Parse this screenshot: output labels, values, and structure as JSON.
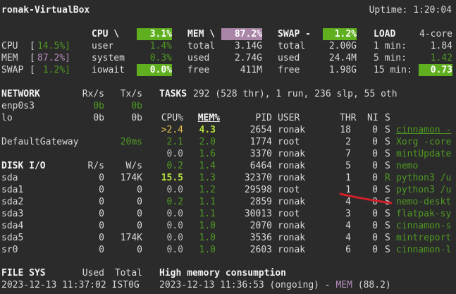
{
  "header": {
    "host": "ronak-VirtualBox",
    "uptime": "Uptime: 1:20:04"
  },
  "quicklook": {
    "cpu": {
      "label": "CPU",
      "bar": "[",
      "value": "14.5%]"
    },
    "mem": {
      "label": "MEM",
      "bar": "[",
      "value": "87.2%]"
    },
    "swap": {
      "label": "SWAP",
      "bar": "[",
      "value": " 1.2%]"
    }
  },
  "cpu_block": {
    "title": "CPU \\",
    "total": "3.1%",
    "rows": [
      {
        "label": "user",
        "value": "1.4%"
      },
      {
        "label": "system",
        "value": "0.3%"
      },
      {
        "label": "iowait",
        "value": "0.0%"
      }
    ]
  },
  "mem_block": {
    "title": "MEM \\",
    "total": "87.2%",
    "rows": [
      {
        "label": "total",
        "value": "3.14G"
      },
      {
        "label": "used",
        "value": "2.74G"
      },
      {
        "label": "free",
        "value": "411M"
      }
    ]
  },
  "swap_block": {
    "title": "SWAP -",
    "total": "1.2%",
    "rows": [
      {
        "label": "total",
        "value": "2.00G"
      },
      {
        "label": "used",
        "value": "24.4M"
      },
      {
        "label": "free",
        "value": "1.98G"
      }
    ]
  },
  "load_block": {
    "title": "LOAD",
    "cores": "4-core",
    "rows": [
      {
        "label": "1 min:",
        "value": "1.84"
      },
      {
        "label": "5 min:",
        "value": "1.42"
      },
      {
        "label": "15 min:",
        "value": "0.73"
      }
    ]
  },
  "network": {
    "title": "NETWORK",
    "rx": "Rx/s",
    "tx": "Tx/s",
    "interfaces": [
      {
        "name": "enp0s3",
        "rx": "0b",
        "tx": "0b"
      },
      {
        "name": "lo",
        "rx": "0b",
        "tx": "0b"
      }
    ],
    "gateway": {
      "label": "DefaultGateway",
      "value": "20ms"
    }
  },
  "diskio": {
    "title": "DISK I/O",
    "r": "R/s",
    "w": "W/s",
    "disks": [
      {
        "name": "sda",
        "r": "0",
        "w": "174K"
      },
      {
        "name": "sda1",
        "r": "0",
        "w": "0"
      },
      {
        "name": "sda2",
        "r": "0",
        "w": "0"
      },
      {
        "name": "sda3",
        "r": "0",
        "w": "0"
      },
      {
        "name": "sda4",
        "r": "0",
        "w": "0"
      },
      {
        "name": "sda5",
        "r": "0",
        "w": "174K"
      },
      {
        "name": "sr0",
        "r": "0",
        "w": "0"
      }
    ]
  },
  "tasks": {
    "title": "TASKS",
    "summary": "292 (528 thr), 1 run, 236 slp, 55 oth"
  },
  "proc_headers": {
    "cpu": "CPU%",
    "mem": "MEM%",
    "pid": "PID",
    "user": "USER",
    "thr": "THR",
    "ni": "NI",
    "s": "S"
  },
  "processes": [
    {
      "cpu": ">2.4",
      "mem": "4.3",
      "pid": "2654",
      "user": "ronak",
      "thr": "18",
      "ni": "0",
      "s": "S",
      "cmd": "cinnamon -"
    },
    {
      "cpu": "2.1",
      "mem": "2.0",
      "pid": "1774",
      "user": "root",
      "thr": "2",
      "ni": "0",
      "s": "S",
      "cmd": "Xorg -core"
    },
    {
      "cpu": "0.0",
      "mem": "1.6",
      "pid": "3370",
      "user": "ronak",
      "thr": "7",
      "ni": "0",
      "s": "S",
      "cmd": "mintUpdate"
    },
    {
      "cpu": "0.2",
      "mem": "1.4",
      "pid": "6464",
      "user": "ronak",
      "thr": "5",
      "ni": "0",
      "s": "S",
      "cmd": "nemo"
    },
    {
      "cpu": "15.5",
      "mem": "1.3",
      "pid": "32370",
      "user": "ronak",
      "thr": "1",
      "ni": "0",
      "s": "R",
      "cmd": "python3 /u"
    },
    {
      "cpu": "0.0",
      "mem": "1.2",
      "pid": "29598",
      "user": "root",
      "thr": "1",
      "ni": "0",
      "s": "S",
      "cmd": "python3 /u"
    },
    {
      "cpu": "0.2",
      "mem": "1.1",
      "pid": "2859",
      "user": "ronak",
      "thr": "4",
      "ni": "0",
      "s": "S",
      "cmd": "nemo-deskt"
    },
    {
      "cpu": "0.0",
      "mem": "1.1",
      "pid": "30013",
      "user": "root",
      "thr": "3",
      "ni": "0",
      "s": "S",
      "cmd": "flatpak-sy"
    },
    {
      "cpu": "0.0",
      "mem": "1.0",
      "pid": "2070",
      "user": "ronak",
      "thr": "4",
      "ni": "0",
      "s": "S",
      "cmd": "cinnamon-s"
    },
    {
      "cpu": "0.0",
      "mem": "1.0",
      "pid": "3536",
      "user": "ronak",
      "thr": "4",
      "ni": "0",
      "s": "S",
      "cmd": "mintreport"
    },
    {
      "cpu": "0.0",
      "mem": "1.0",
      "pid": "2603",
      "user": "ronak",
      "thr": "6",
      "ni": "0",
      "s": "S",
      "cmd": "cinnamon-l"
    }
  ],
  "filesys": {
    "title": "FILE SYS",
    "used": "Used",
    "total": "Total"
  },
  "alert": {
    "title": "High memory consumption",
    "line_prefix": "2023-12-13 11:36:53 (ongoing) - ",
    "mem": "MEM",
    "value": " (88.2)"
  },
  "footer": {
    "timestamp": "2023-12-13 11:37:02 IST0G"
  },
  "colors": {
    "background": "#2b2b2b",
    "ok_green": "#5faf1f",
    "careful_purple": "#a985a7",
    "annotation_red": "#d0202a"
  }
}
